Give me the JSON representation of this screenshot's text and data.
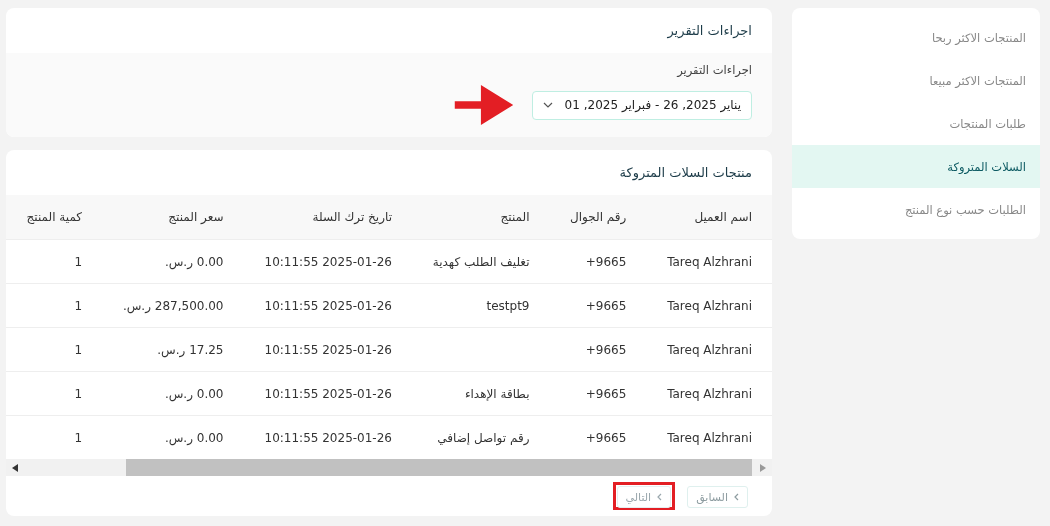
{
  "sidebar": {
    "items": [
      {
        "label": "المنتجات الاكثر ربحا",
        "selected": false
      },
      {
        "label": "المنتجات الاكثر مبيعا",
        "selected": false
      },
      {
        "label": "طلبات المنتجات",
        "selected": false
      },
      {
        "label": "السلات المتروكة",
        "selected": true
      },
      {
        "label": "الطلبات حسب نوع المنتج",
        "selected": false
      }
    ]
  },
  "report_actions": {
    "title": "اجراءات التقرير",
    "date_range": {
      "label": "اجراءات التقرير",
      "value": "يناير 2025, 26 - فبراير 2025, 01"
    }
  },
  "abandoned_carts": {
    "title": "منتجات السلات المتروكة",
    "table": {
      "columns": [
        "اسم العميل",
        "رقم الجوال",
        "المنتج",
        "تاريخ ترك السلة",
        "سعر المنتج",
        "كمية المنتج"
      ],
      "rows": [
        [
          "Tareq Alzhrani",
          "+9665",
          "تغليف الطلب كهدية",
          "2025-01-26 10:11:55",
          "0.00 ر.س.",
          "1"
        ],
        [
          "Tareq Alzhrani",
          "+9665",
          "testpt9",
          "2025-01-26 10:11:55",
          "287,500.00 ر.س.",
          "1"
        ],
        [
          "Tareq Alzhrani",
          "+9665",
          "",
          "2025-01-26 10:11:55",
          "17.25 ر.س.",
          "1"
        ],
        [
          "Tareq Alzhrani",
          "+9665",
          "بطاقة الإهداء",
          "2025-01-26 10:11:55",
          "0.00 ر.س.",
          "1"
        ],
        [
          "Tareq Alzhrani",
          "+9665",
          "رقم تواصل إضافي",
          "2025-01-26 10:11:55",
          "0.00 ر.س.",
          "1"
        ]
      ]
    },
    "pagination": [
      {
        "label": "السابق",
        "disabled": true
      },
      {
        "label": "التالي",
        "disabled": false,
        "highlighted": true
      }
    ]
  }
}
